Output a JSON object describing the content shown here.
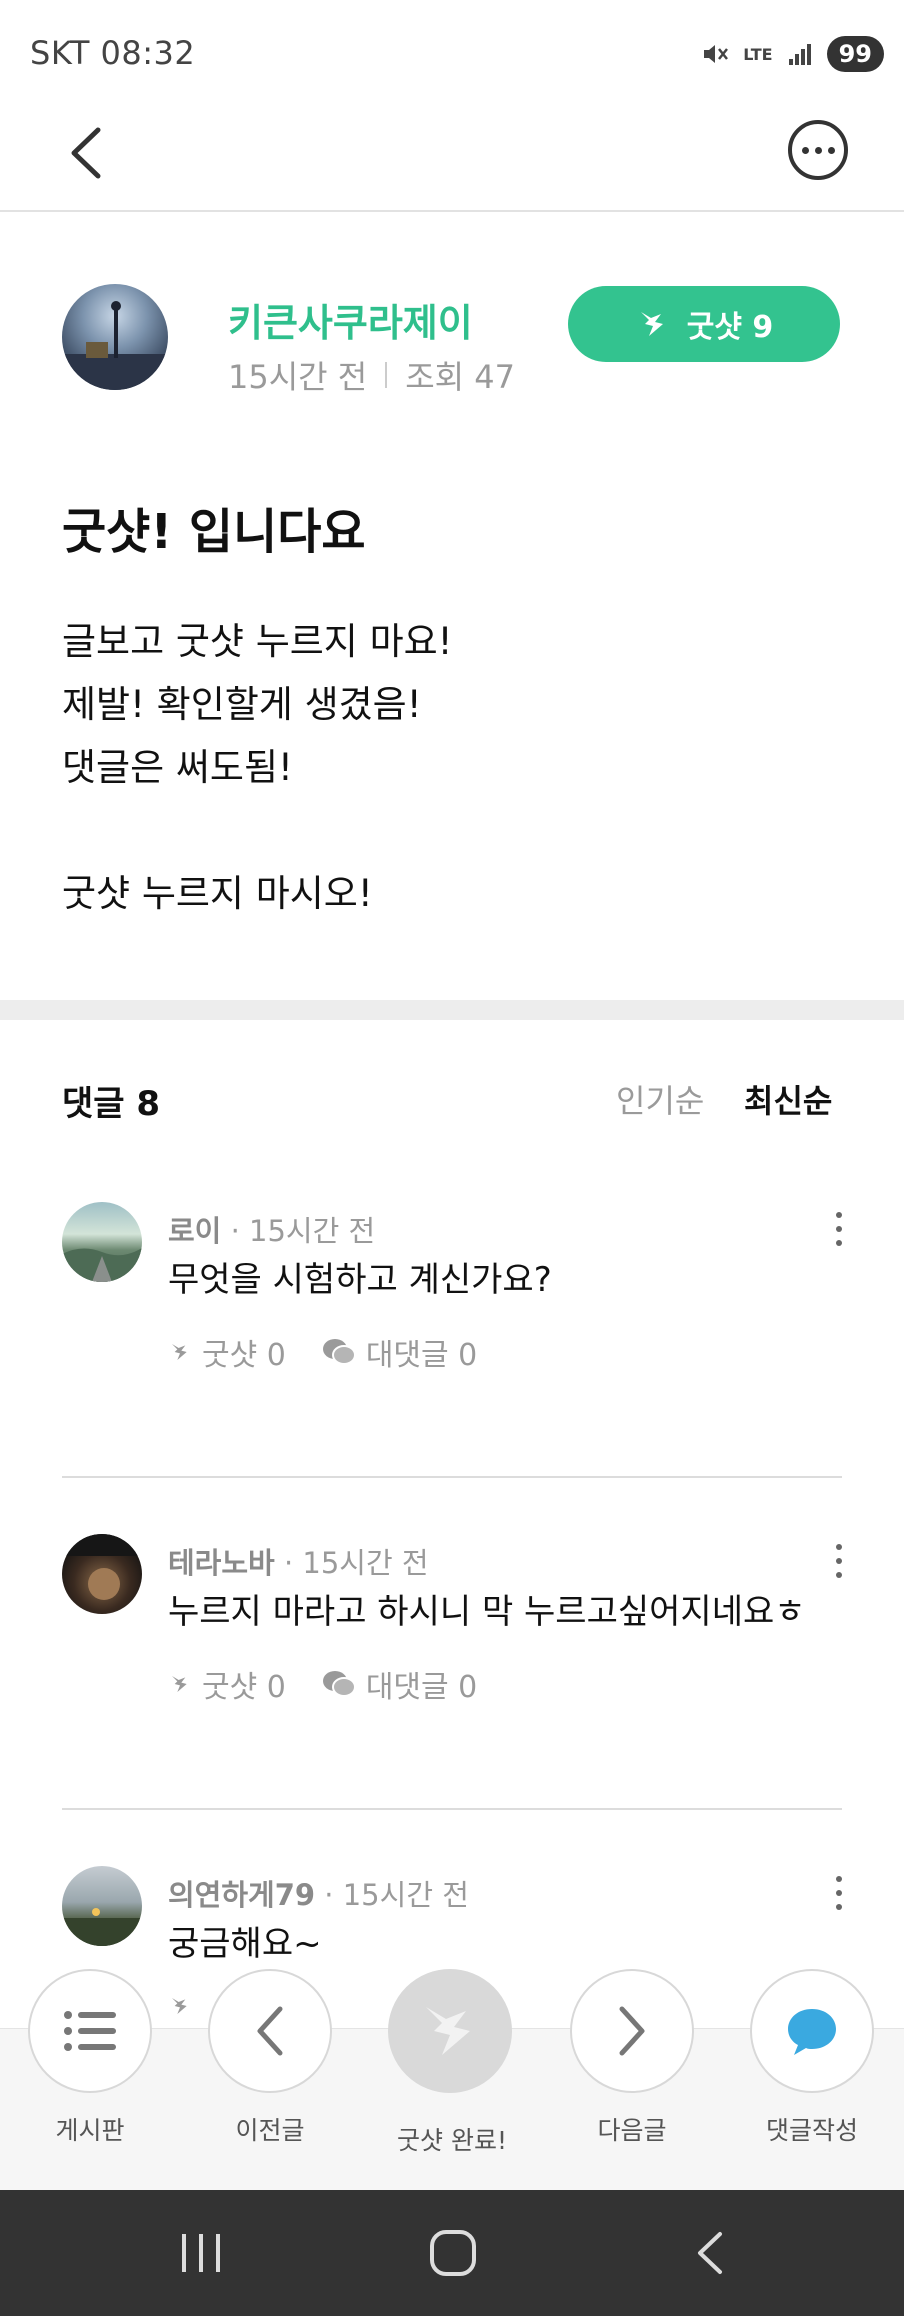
{
  "status_bar": {
    "carrier_time": "SKT 08:32",
    "network": "LTE",
    "battery": "99"
  },
  "author": {
    "name": "키큰사쿠라제이",
    "time": "15시간 전",
    "views": "조회 47"
  },
  "like_button": {
    "label": "굿샷 9"
  },
  "post": {
    "title": "굿샷! 입니다요",
    "body_lines": [
      "글보고 굿샷 누르지 마요!",
      "제발! 확인할게 생겼음!",
      "댓글은 써도됨!",
      "",
      "굿샷 누르지 마시오!"
    ]
  },
  "comments_header": {
    "title": "댓글 8",
    "sort_popular": "인기순",
    "sort_latest": "최신순"
  },
  "comments": [
    {
      "author": "로이",
      "time": "· 15시간 전",
      "text": "무엇을 시험하고 계신가요?",
      "likes": "굿샷 0",
      "replies": "대댓글 0"
    },
    {
      "author": "테라노바",
      "time": "· 15시간 전",
      "text": "누르지 마라고 하시니 막 누르고싶어지네요ㅎ",
      "likes": "굿샷 0",
      "replies": "대댓글 0"
    },
    {
      "author": "의연하게79",
      "time": "· 15시간 전",
      "text": "궁금해요~",
      "likes": "",
      "replies": ""
    }
  ],
  "bottom_bar": {
    "board": "게시판",
    "prev": "이전글",
    "liked": "굿샷 완료!",
    "next": "다음글",
    "write_comment": "댓글작성"
  },
  "colors": {
    "accent": "#33c38f",
    "author_name": "#2fbf8c",
    "comment_bubble": "#3aa9e0",
    "system_nav": "#333333"
  }
}
